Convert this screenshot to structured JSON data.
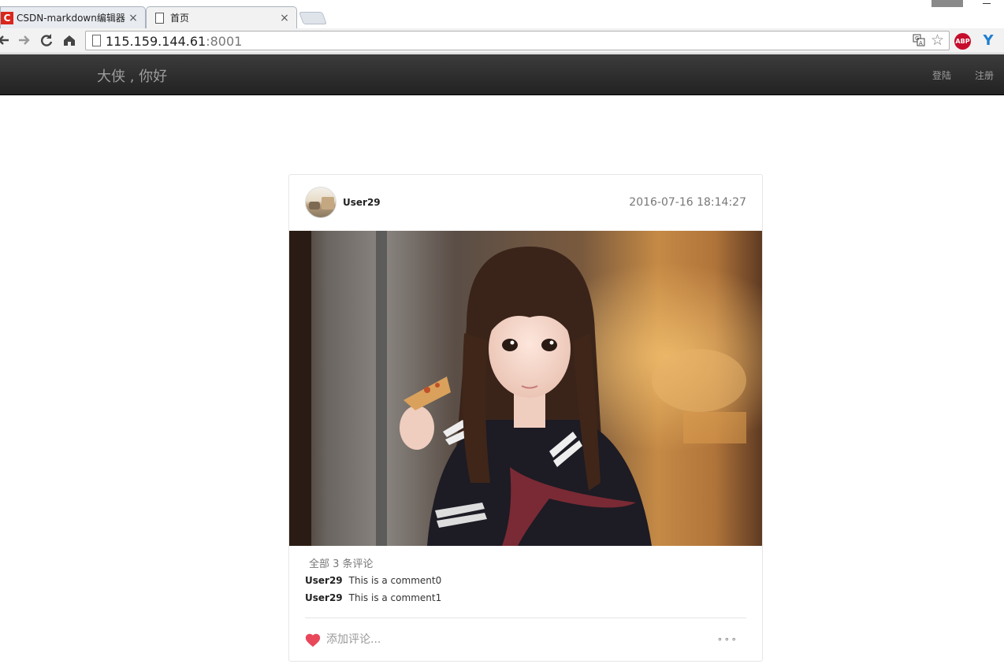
{
  "browser": {
    "tabs": [
      {
        "favicon": "C",
        "label": "CSDN-markdown编辑器",
        "close": "×"
      },
      {
        "label": "首页",
        "close": "×"
      }
    ],
    "url_host": "115.159.144.61",
    "url_port": ":8001",
    "abp_label": "ABP",
    "ext_label": "Y",
    "icons": {
      "back": "back-arrow-icon",
      "forward": "forward-arrow-icon",
      "reload": "reload-icon",
      "home": "home-icon",
      "translate": "translate-icon",
      "bookmark": "star-icon"
    }
  },
  "site": {
    "brand": "大侠 , 你好",
    "nav": {
      "login": "登陆",
      "register": "注册"
    }
  },
  "post": {
    "username": "User29",
    "timestamp": "2016-07-16 18:14:27",
    "comment_count": "全部 3 条评论",
    "comments": [
      {
        "user": "User29",
        "text": "This is a comment0"
      },
      {
        "user": "User29",
        "text": "This is a comment1"
      }
    ],
    "add_comment_placeholder": "添加评论...",
    "more_label": "∘∘∘",
    "accent_color": "#e9485a"
  }
}
